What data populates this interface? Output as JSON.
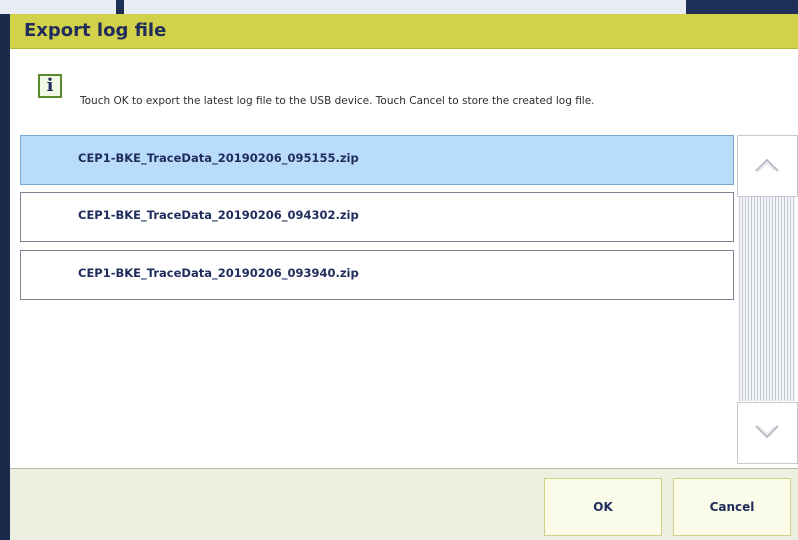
{
  "dialog": {
    "title": "Export log file",
    "message": "Touch OK to export the latest log file to the USB device. Touch Cancel to store the created log file.",
    "info_icon": "info-icon",
    "info_glyph": "i"
  },
  "files": [
    {
      "name": "CEP1-BKE_TraceData_20190206_095155.zip",
      "selected": true
    },
    {
      "name": "CEP1-BKE_TraceData_20190206_094302.zip",
      "selected": false
    },
    {
      "name": "CEP1-BKE_TraceData_20190206_093940.zip",
      "selected": false
    }
  ],
  "buttons": {
    "ok": "OK",
    "cancel": "Cancel"
  },
  "colors": {
    "title_bar": "#d2d24a",
    "selected_row": "#b9dcfb",
    "text": "#1f2c5c",
    "footer": "#eef0df"
  }
}
